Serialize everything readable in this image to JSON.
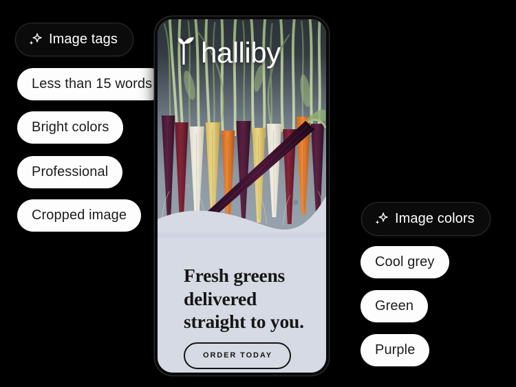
{
  "background_color": "#000000",
  "groups": [
    {
      "id": "image-tags",
      "header": {
        "label": "Image tags",
        "icon": "sparkle-icon"
      },
      "items": [
        {
          "label": "Less than 15 words"
        },
        {
          "label": "Bright colors"
        },
        {
          "label": "Professional"
        },
        {
          "label": "Cropped image"
        }
      ]
    },
    {
      "id": "image-colors",
      "header": {
        "label": "Image colors",
        "icon": "sparkle-icon"
      },
      "items": [
        {
          "label": "Cool grey"
        },
        {
          "label": "Green"
        },
        {
          "label": "Purple"
        }
      ]
    }
  ],
  "preview": {
    "brand": {
      "wordmark": "halliby",
      "icon": "leaf-sprout-icon",
      "color": "#ffffff"
    },
    "headline": "Fresh greens delivered straight to you.",
    "headline_lines": [
      "Fresh greens",
      "delivered",
      "straight to you."
    ],
    "cta": {
      "label": "ORDER TODAY"
    },
    "panel_color": "#d6dae4",
    "text_color": "#161616",
    "photo_subject": "heirloom rainbow carrots with green tops on grey stone"
  }
}
